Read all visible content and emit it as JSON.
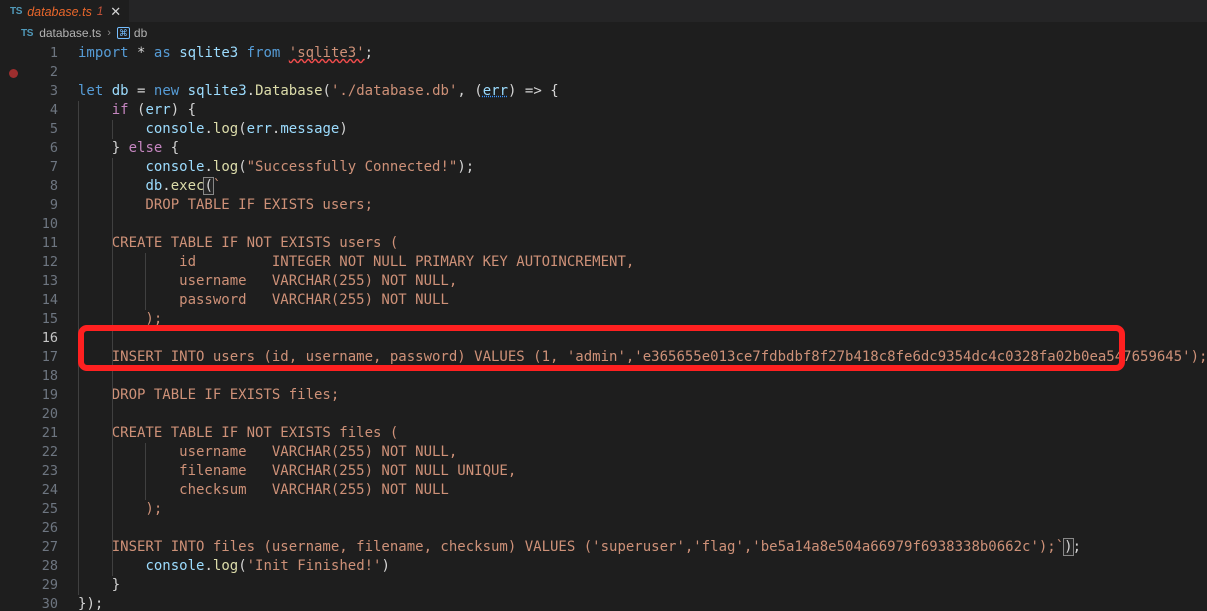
{
  "window": {
    "app": "vscode-editor",
    "colors": {
      "background": "#1e1e1e",
      "tabbar_background": "#252526",
      "annotation_red": "#ff2020",
      "string": "#ce9178",
      "keyword": "#569cd6",
      "control_keyword": "#c586c0",
      "variable": "#9cdcfe",
      "function": "#dcdcaa",
      "type": "#4ec9b0",
      "number": "#b5cea8",
      "linenumber": "#6e7681",
      "linenumber_active": "#c6c6c6",
      "breakpoint": "#9d2e2e"
    }
  },
  "tabbar": {
    "tabs": [
      {
        "icon": "typescript-file-icon",
        "icon_label": "TS",
        "label": "database.ts",
        "dirty_count": "1",
        "close_label": "✕",
        "active": true,
        "modified": true
      }
    ]
  },
  "breadcrumb": {
    "file_icon_label": "TS",
    "file_label": "database.ts",
    "separator": "›",
    "symbol_icon_label": "⌘",
    "symbol_label": "db"
  },
  "editor": {
    "language": "typescript",
    "active_line": 16,
    "breakpoint_lines": [
      2
    ],
    "lines": [
      {
        "n": "1",
        "text": "import * as sqlite3 from 'sqlite3';"
      },
      {
        "n": "2",
        "text": ""
      },
      {
        "n": "3",
        "text": "let db = new sqlite3.Database('./database.db', (err) => {"
      },
      {
        "n": "4",
        "text": "    if (err) {"
      },
      {
        "n": "5",
        "text": "        console.log(err.message)"
      },
      {
        "n": "6",
        "text": "    } else {"
      },
      {
        "n": "7",
        "text": "        console.log(\"Successfully Connected!\");"
      },
      {
        "n": "8",
        "text": "        db.exec(`"
      },
      {
        "n": "9",
        "text": "        DROP TABLE IF EXISTS users;"
      },
      {
        "n": "10",
        "text": ""
      },
      {
        "n": "11",
        "text": "    CREATE TABLE IF NOT EXISTS users ("
      },
      {
        "n": "12",
        "text": "            id         INTEGER NOT NULL PRIMARY KEY AUTOINCREMENT,"
      },
      {
        "n": "13",
        "text": "            username   VARCHAR(255) NOT NULL,"
      },
      {
        "n": "14",
        "text": "            password   VARCHAR(255) NOT NULL"
      },
      {
        "n": "15",
        "text": "        );"
      },
      {
        "n": "16",
        "text": ""
      },
      {
        "n": "17",
        "text": "    INSERT INTO users (id, username, password) VALUES (1, 'admin','e365655e013ce7fdbdbf8f27b418c8fe6dc9354dc4c0328fa02b0ea547659645');"
      },
      {
        "n": "18",
        "text": ""
      },
      {
        "n": "19",
        "text": "    DROP TABLE IF EXISTS files;"
      },
      {
        "n": "20",
        "text": ""
      },
      {
        "n": "21",
        "text": "    CREATE TABLE IF NOT EXISTS files ("
      },
      {
        "n": "22",
        "text": "            username   VARCHAR(255) NOT NULL,"
      },
      {
        "n": "23",
        "text": "            filename   VARCHAR(255) NOT NULL UNIQUE,"
      },
      {
        "n": "24",
        "text": "            checksum   VARCHAR(255) NOT NULL"
      },
      {
        "n": "25",
        "text": "        );"
      },
      {
        "n": "26",
        "text": ""
      },
      {
        "n": "27",
        "text": "    INSERT INTO files (username, filename, checksum) VALUES ('superuser','flag','be5a14a8e504a66979f6938338b0662c');`);"
      },
      {
        "n": "28",
        "text": "        console.log('Init Finished!')"
      },
      {
        "n": "29",
        "text": "    }"
      },
      {
        "n": "30",
        "text": "});"
      }
    ],
    "values": {
      "db_path": "./database.db",
      "connect_message": "Successfully Connected!",
      "init_message": "Init Finished!",
      "admin_username": "admin",
      "admin_password_hash": "e365655e013ce7fdbdbf8f27b418c8fe6dc9354dc4c0328fa02b0ea547659645",
      "file_owner": "superuser",
      "file_name": "flag",
      "file_checksum": "be5a14a8e504a66979f6938338b0662c"
    }
  },
  "annotation": {
    "type": "red-rectangle-highlight",
    "highlighted_line_numbers": "16-17",
    "color": "#ff2020"
  }
}
